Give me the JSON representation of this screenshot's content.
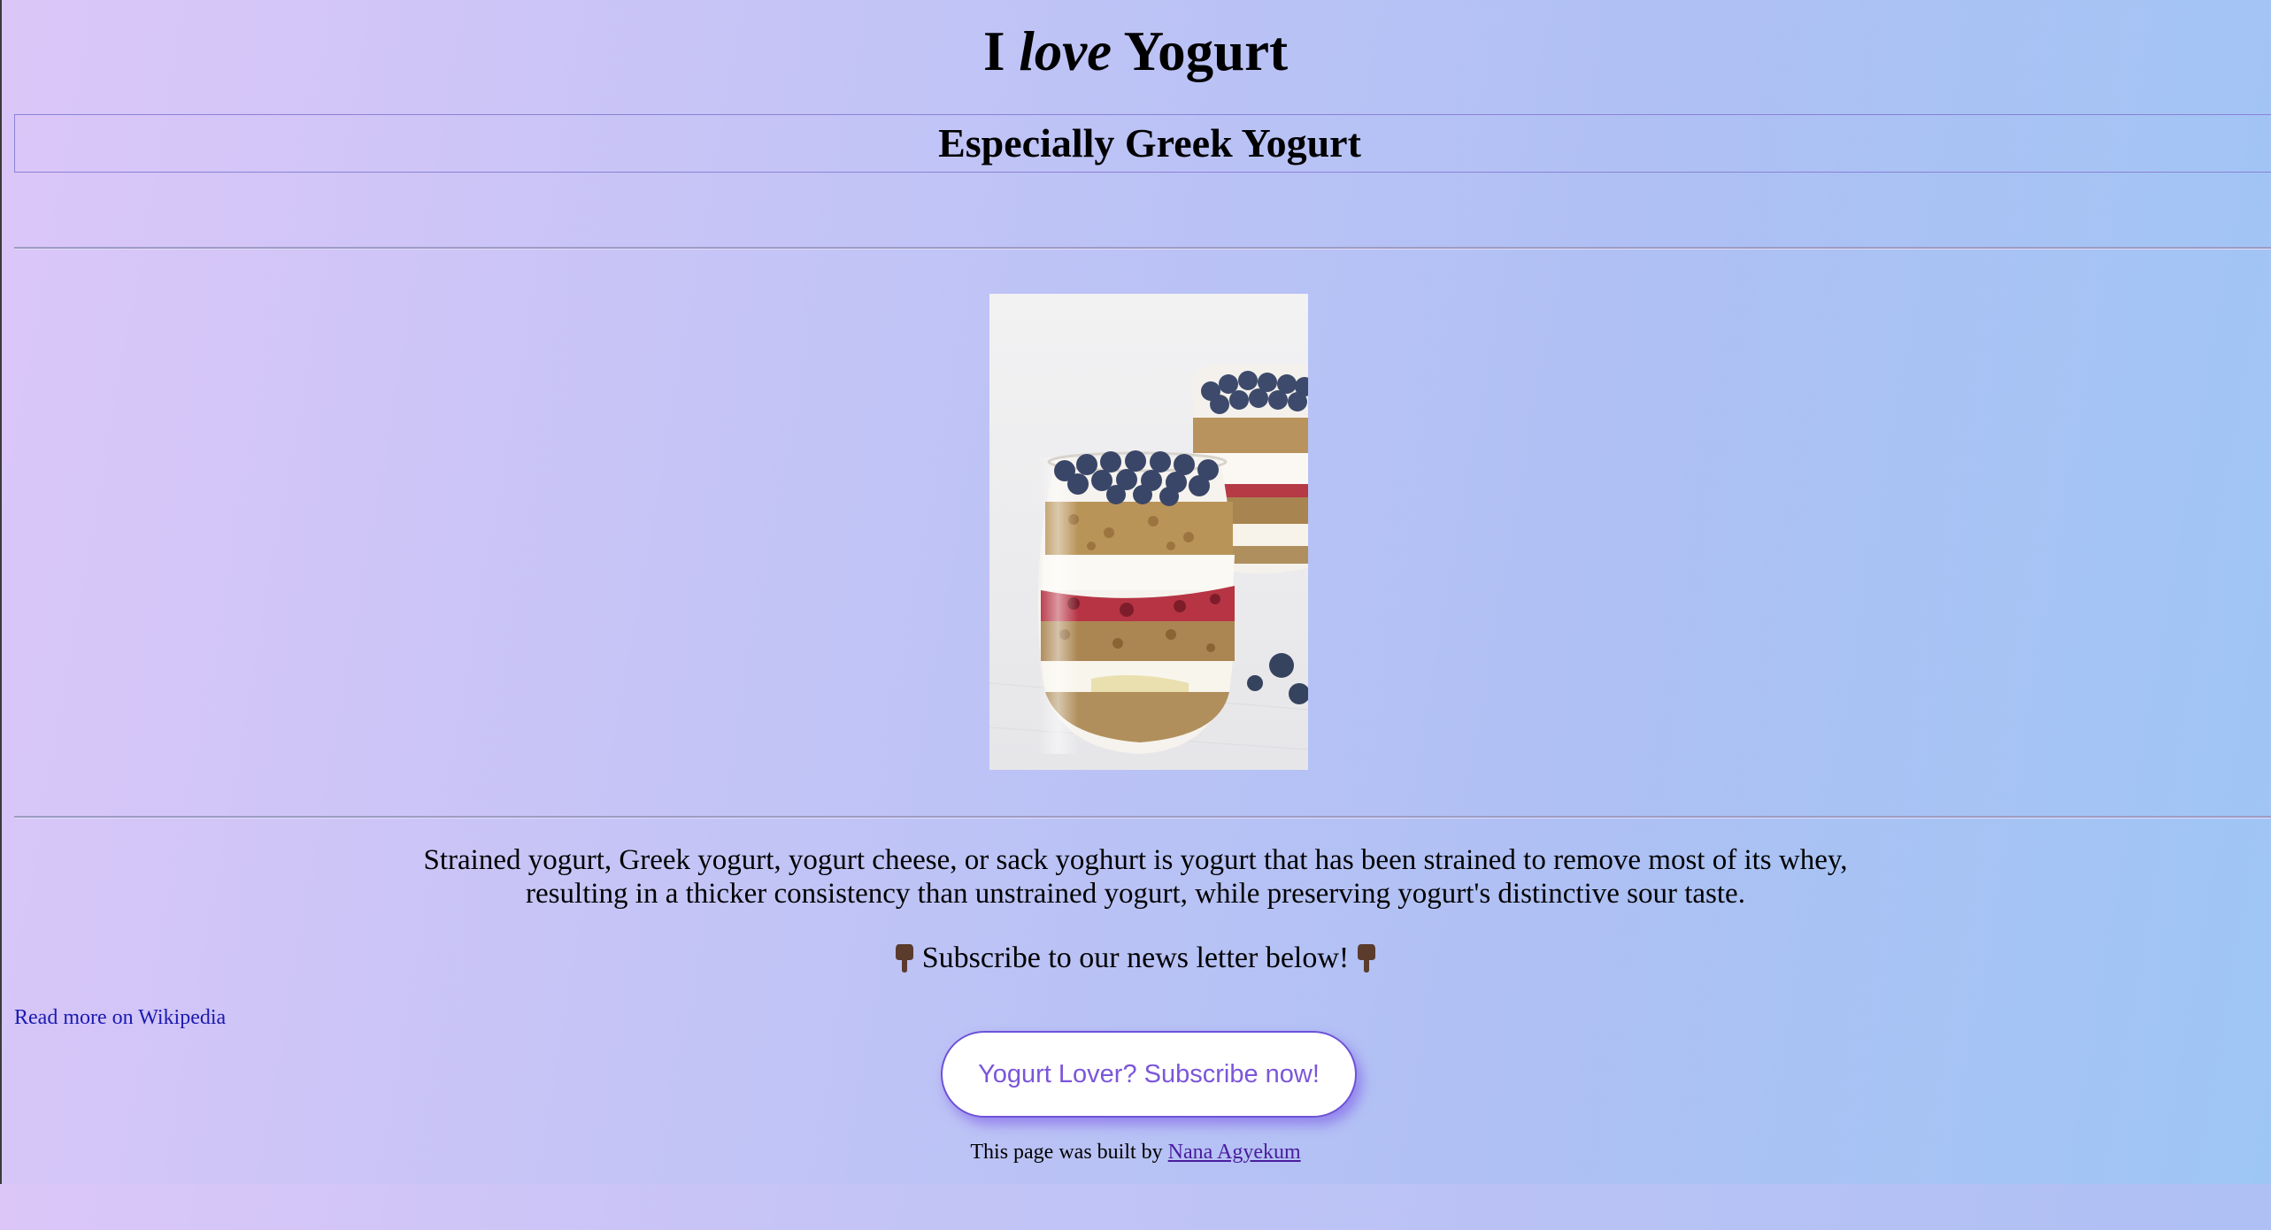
{
  "header": {
    "title_pre": "I ",
    "title_em": "love",
    "title_post": " Yogurt",
    "subtitle": "Especially Greek Yogurt"
  },
  "main": {
    "description_line1": "Strained yogurt, Greek yogurt, yogurt cheese, or sack yoghurt is yogurt that has been strained to remove most of its whey,",
    "description_line2": "resulting in a thicker consistency than unstrained yogurt, while preserving yogurt's distinctive sour taste.",
    "cta_text": "Subscribe to our news letter below!",
    "cta_icon": "pointing-down-hand-icon",
    "wiki_link": "Read more on Wikipedia",
    "subscribe_button": "Yogurt Lover? Subscribe now!"
  },
  "footer": {
    "text": "This page was built by ",
    "author": "Nana Agyekum"
  },
  "colors": {
    "gradient_start": "#dcc6f8",
    "gradient_end": "#9ec6f5",
    "button_text": "#7b56d9",
    "link": "#1a1ab0"
  }
}
